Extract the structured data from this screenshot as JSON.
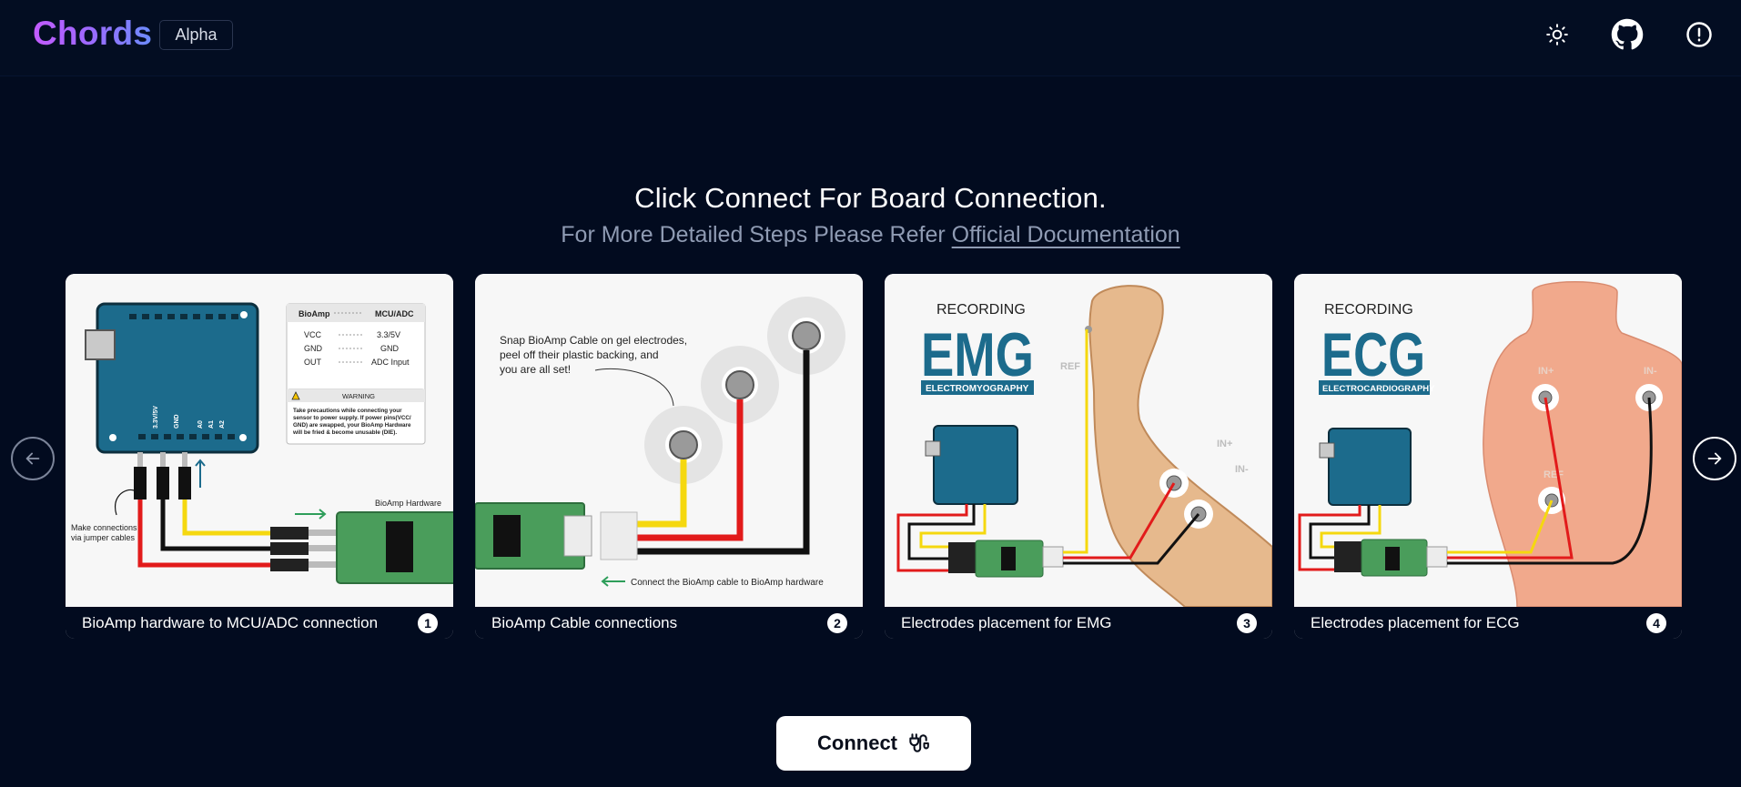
{
  "header": {
    "logo": "Chords",
    "badge": "Alpha",
    "icons": [
      "sun-icon",
      "github-icon",
      "info-icon"
    ]
  },
  "main": {
    "title": "Click Connect For Board Connection.",
    "subtitle_prefix": "For More Detailed Steps Please Refer ",
    "doc_link": "Official Documentation"
  },
  "carousel": {
    "prev_icon": "arrow-left-icon",
    "next_icon": "arrow-right-icon",
    "slides": [
      {
        "caption": "BioAmp hardware to MCU/ADC connection",
        "number": "1",
        "text": {
          "table_header_left": "BioAmp",
          "table_header_right": "MCU/ADC",
          "row1_left": "VCC",
          "row1_right": "3.3/5V",
          "row2_left": "GND",
          "row2_right": "GND",
          "row3_left": "OUT",
          "row3_right": "ADC Input",
          "warning_title": "WARNING",
          "warning_1": "Take precautions while connecting your",
          "warning_2": "sensor to power supply. If power pins(VCC/",
          "warning_3": "GND) are swapped, your BioAmp Hardware",
          "warning_4": "will be fried & become unusable (DIE).",
          "note_1": "Make connections",
          "note_2": "via jumper cables",
          "hw_label": "BioAmp Hardware",
          "pin_1": "3.3V/5V",
          "pin_2": "GND",
          "pin_3": "A0",
          "pin_4": "A1",
          "pin_5": "A2"
        }
      },
      {
        "caption": "BioAmp Cable connections",
        "number": "2",
        "text": {
          "note_1": "Snap BioAmp Cable on gel electrodes,",
          "note_2": "peel off their plastic backing, and",
          "note_3": "you are all set!",
          "bottom": "Connect the BioAmp cable to BioAmp hardware"
        }
      },
      {
        "caption": "Electrodes placement for EMG",
        "number": "3",
        "text": {
          "recording": "RECORDING",
          "big": "EMG",
          "sub": "ELECTROMYOGRAPHY",
          "ref": "REF",
          "in_plus": "IN+",
          "in_minus": "IN-"
        }
      },
      {
        "caption": "Electrodes placement for ECG",
        "number": "4",
        "text": {
          "recording": "RECORDING",
          "big": "ECG",
          "sub": "ELECTROCARDIOGRAPHY",
          "ref": "REF",
          "in_plus": "IN+",
          "in_minus": "IN-"
        }
      }
    ]
  },
  "connect": {
    "label": "Connect",
    "icon": "plug-icon"
  },
  "colors": {
    "background": "#020b1f",
    "logo_gradient_start": "#c35bff",
    "logo_gradient_end": "#6c8cff",
    "board_teal": "#1c6b8c",
    "bioamp_green": "#4a9d5b"
  }
}
